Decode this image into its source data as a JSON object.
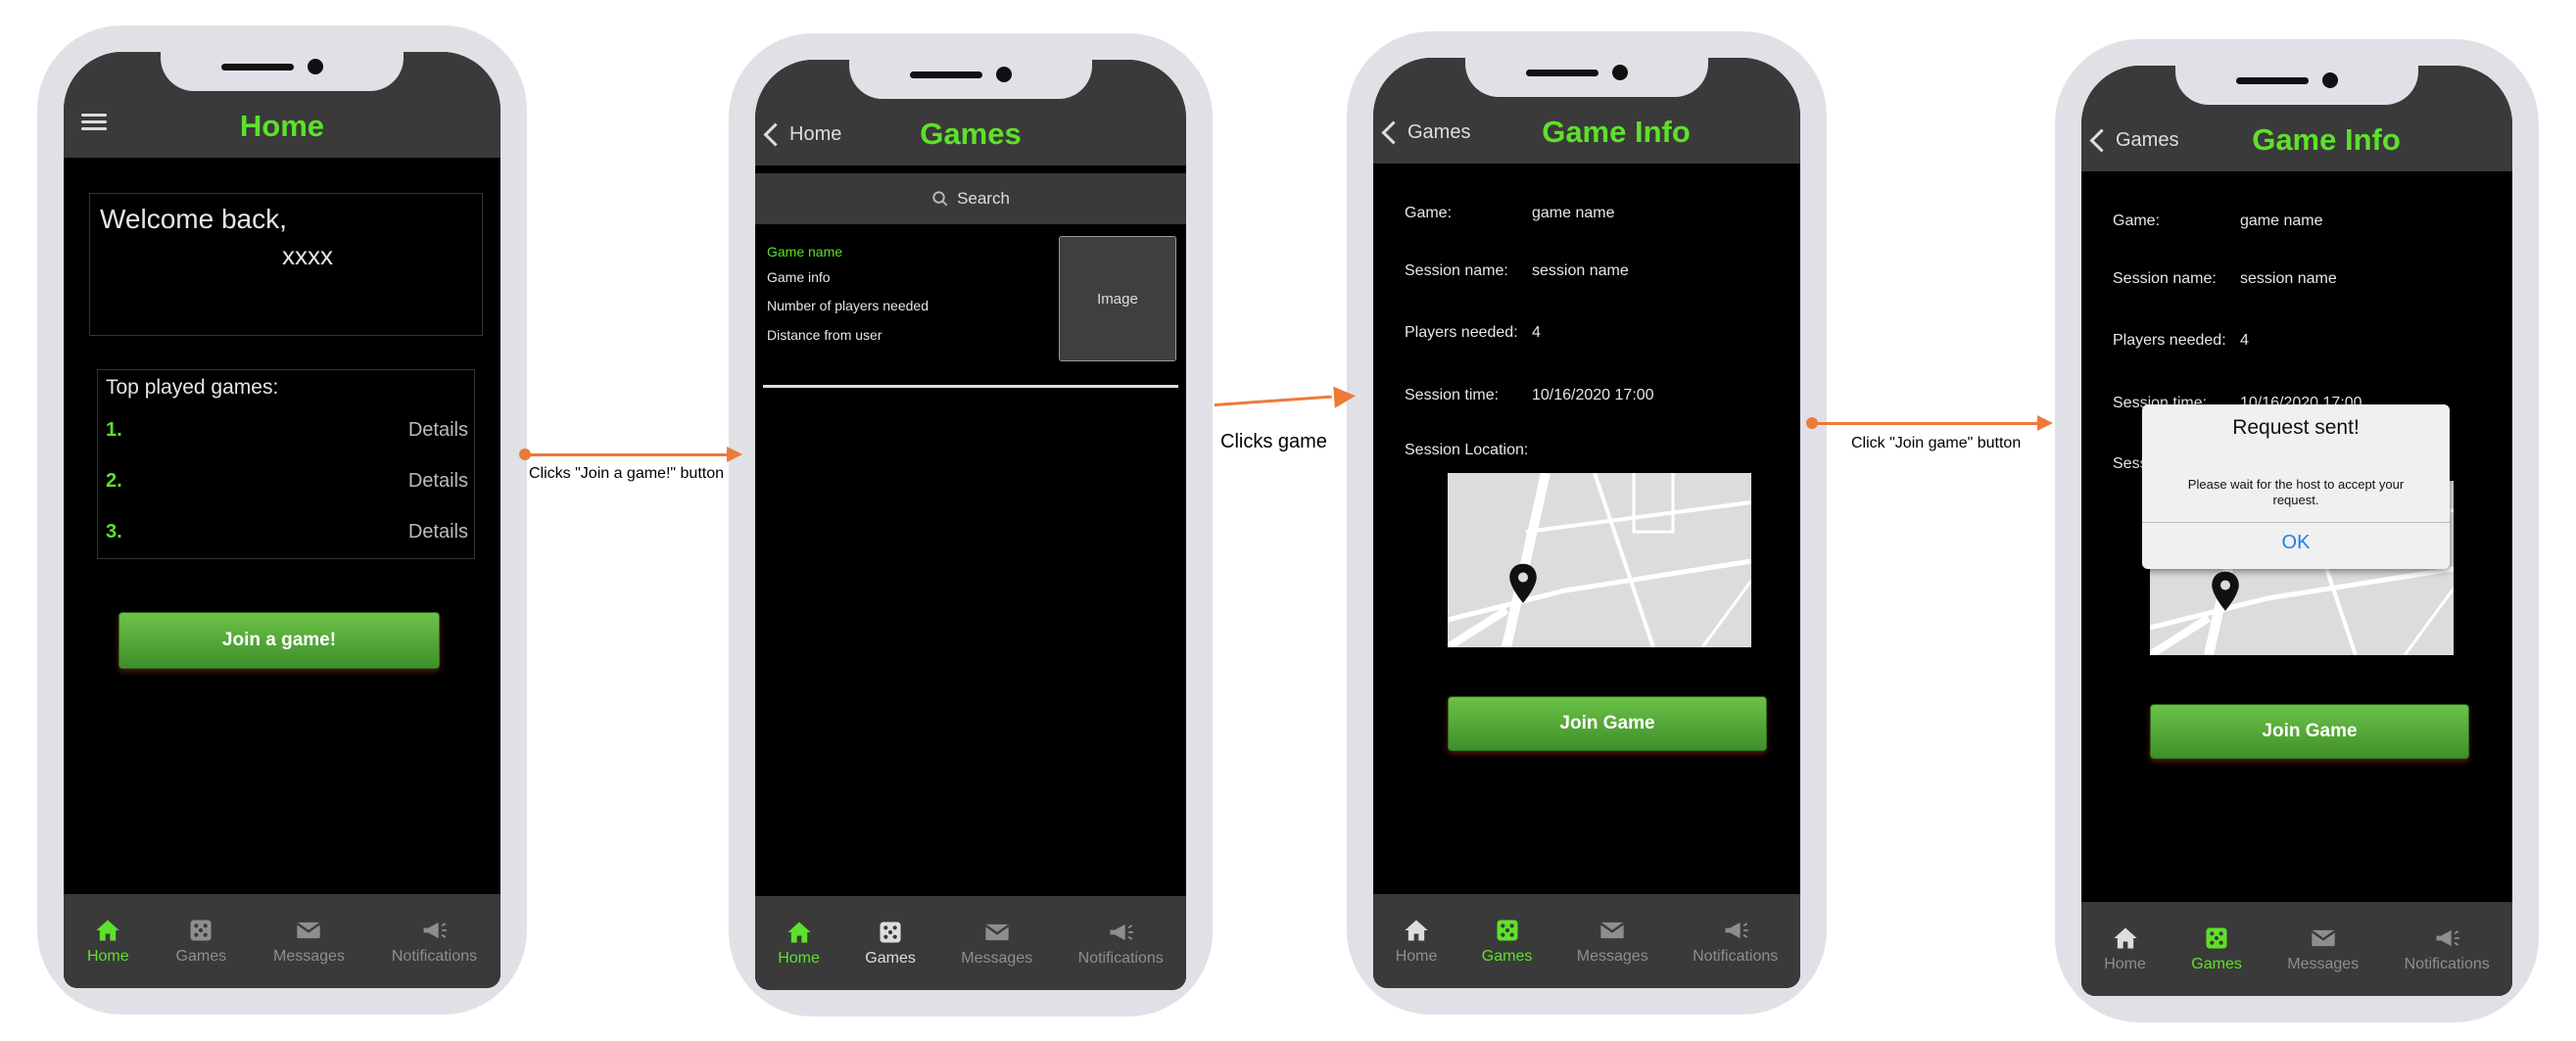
{
  "tabs": {
    "home": "Home",
    "games": "Games",
    "messages": "Messages",
    "notifications": "Notifications"
  },
  "screen1": {
    "title": "Home",
    "welcome_line1": "Welcome back,",
    "welcome_line2": "xxxx",
    "top_played_title": "Top played games:",
    "top_items": [
      {
        "num": "1.",
        "action": "Details"
      },
      {
        "num": "2.",
        "action": "Details"
      },
      {
        "num": "3.",
        "action": "Details"
      }
    ],
    "join_button": "Join a game!"
  },
  "screen2": {
    "back_label": "Home",
    "title": "Games",
    "search_placeholder": "Search",
    "game_name": "Game name",
    "game_info": "Game info",
    "players_needed": "Number of players needed",
    "distance": "Distance from user",
    "image_label": "Image"
  },
  "screen3": {
    "back_label": "Games",
    "title": "Game Info",
    "rows": [
      {
        "label": "Game:",
        "value": "game name"
      },
      {
        "label": "Session name:",
        "value": "session name"
      },
      {
        "label": "Players needed:",
        "value": "4"
      },
      {
        "label": "Session time:",
        "value": "10/16/2020 17:00"
      }
    ],
    "location_label": "Session Location:",
    "join_button": "Join Game"
  },
  "screen4": {
    "back_label": "Games",
    "title": "Game Info",
    "rows": [
      {
        "label": "Game:",
        "value": "game name"
      },
      {
        "label": "Session name:",
        "value": "session name"
      },
      {
        "label": "Players needed:",
        "value": "4"
      },
      {
        "label": "Session time:",
        "value": "10/16/2020 17:00"
      }
    ],
    "location_partial": "Sess",
    "dialog_title": "Request sent!",
    "dialog_message": "Please wait for the host to accept your request.",
    "dialog_ok": "OK",
    "join_button": "Join Game"
  },
  "annotations": {
    "a1": "Clicks \"Join a game!\" button",
    "a2": "Clicks game",
    "a3": "Click \"Join game\" button"
  },
  "colors": {
    "accent_green": "#5ee12b",
    "header_bg": "#3a3a3a",
    "arrow_orange": "#ec7a3a",
    "phone_frame": "#dfe1e6"
  }
}
